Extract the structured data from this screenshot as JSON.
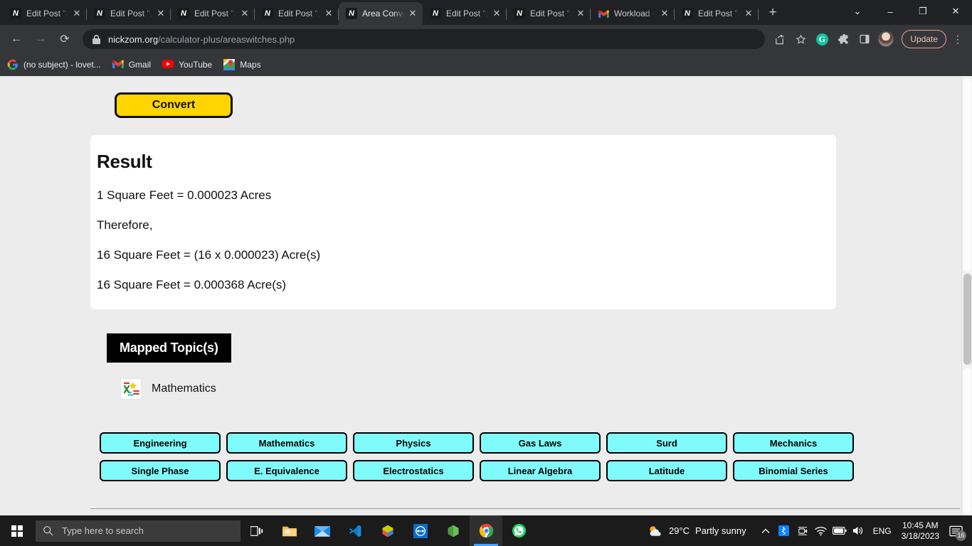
{
  "browser": {
    "tabs": [
      {
        "title": "Edit Post \"...",
        "favicon": "nickzom-icon",
        "active": false
      },
      {
        "title": "Edit Post \"...",
        "favicon": "nickzom-icon",
        "active": false
      },
      {
        "title": "Edit Post \"...",
        "favicon": "nickzom-icon",
        "active": false
      },
      {
        "title": "Edit Post \"...",
        "favicon": "nickzom-icon",
        "active": false
      },
      {
        "title": "Area Conve...",
        "favicon": "nickzom-icon",
        "active": true
      },
      {
        "title": "Edit Post \"...",
        "favicon": "nickzom-icon",
        "active": false
      },
      {
        "title": "Edit Post \"...",
        "favicon": "nickzom-icon",
        "active": false
      },
      {
        "title": "Workload -",
        "favicon": "gmail-icon",
        "active": false
      },
      {
        "title": "Edit Post \"...",
        "favicon": "nickzom-icon",
        "active": false
      }
    ],
    "new_tab_label": "+",
    "window_controls": {
      "minimize": "–",
      "maximize": "❐",
      "close": "✕",
      "tab_search": "⌄"
    },
    "toolbar": {
      "back_label": "←",
      "forward_label": "→",
      "reload_label": "⟳",
      "url_domain": "nickzom.org",
      "url_path": "/calculator-plus/areaswitches.php",
      "update_label": "Update",
      "grammarly_label": "G"
    },
    "bookmarks": [
      {
        "label": "(no subject) - lovet...",
        "icon": "google-icon"
      },
      {
        "label": "Gmail",
        "icon": "gmail-icon"
      },
      {
        "label": "YouTube",
        "icon": "youtube-icon"
      },
      {
        "label": "Maps",
        "icon": "maps-icon"
      }
    ]
  },
  "page": {
    "convert_button": "Convert",
    "result": {
      "title": "Result",
      "lines": [
        "1 Square Feet = 0.000023 Acres",
        "Therefore,",
        "16 Square Feet = (16 x 0.000023) Acre(s)",
        "16 Square Feet = 0.000368 Acre(s)"
      ]
    },
    "mapped_topics": {
      "header": "Mapped Topic(s)",
      "items": [
        {
          "label": "Mathematics",
          "icon": "mathematics-icon"
        }
      ]
    },
    "tags": [
      "Engineering",
      "Mathematics",
      "Physics",
      "Gas Laws",
      "Surd",
      "Mechanics",
      "Single Phase",
      "E. Equivalence",
      "Electrostatics",
      "Linear Algebra",
      "Latitude",
      "Binomial Series"
    ]
  },
  "taskbar": {
    "start_label": "start-icon",
    "search_placeholder": "Type here to search",
    "pinned": [
      "task-view-icon",
      "file-explorer-icon",
      "mail-icon",
      "vscode-icon",
      "3d-viewer-icon",
      "teamviewer-icon",
      "node-icon",
      "chrome-icon",
      "whatsapp-icon"
    ],
    "weather_temp": "29°C",
    "weather_desc": "Partly sunny",
    "tray_language": "ENG",
    "clock_time": "10:45 AM",
    "clock_date": "3/18/2023",
    "notification_count": "16"
  },
  "colors": {
    "accent_yellow": "#ffd400",
    "tag_cyan": "#7ffbfb",
    "page_bg": "#ececec",
    "chrome_bg": "#202124",
    "toolbar_bg": "#35363a"
  }
}
